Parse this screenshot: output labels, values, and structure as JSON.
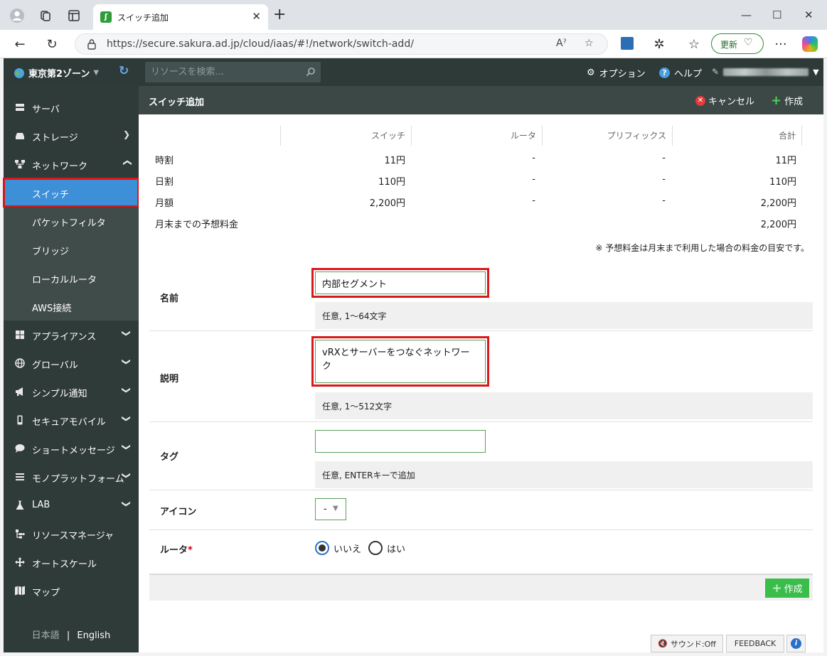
{
  "browser": {
    "tab_title": "スイッチ追加",
    "url": "https://secure.sakura.ad.jp/cloud/iaas/#!/network/switch-add/",
    "update_label": "更新"
  },
  "header": {
    "zone": "東京第2ゾーン",
    "search_placeholder": "リソースを検索...",
    "options_label": "オプション",
    "help_label": "ヘルプ"
  },
  "sidebar": {
    "items": [
      {
        "label": "サーバ",
        "icon": "server-icon"
      },
      {
        "label": "ストレージ",
        "icon": "storage-icon"
      },
      {
        "label": "ネットワーク",
        "icon": "network-icon"
      },
      {
        "label": "スイッチ"
      },
      {
        "label": "パケットフィルタ"
      },
      {
        "label": "ブリッジ"
      },
      {
        "label": "ローカルルータ"
      },
      {
        "label": "AWS接続"
      },
      {
        "label": "アプライアンス",
        "icon": "appliance-icon"
      },
      {
        "label": "グローバル",
        "icon": "globe-icon"
      },
      {
        "label": "シンプル通知",
        "icon": "megaphone-icon"
      },
      {
        "label": "セキュアモバイル",
        "icon": "mobile-icon"
      },
      {
        "label": "ショートメッセージ",
        "icon": "chat-icon"
      },
      {
        "label": "モノプラットフォーム",
        "icon": "list-icon"
      },
      {
        "label": "LAB",
        "icon": "flask-icon"
      },
      {
        "label": "リソースマネージャ",
        "icon": "sitemap-icon"
      },
      {
        "label": "オートスケール",
        "icon": "move-icon"
      },
      {
        "label": "マップ",
        "icon": "map-icon"
      }
    ],
    "lang_ja": "日本語",
    "lang_sep": "|",
    "lang_en": "English"
  },
  "panel": {
    "title": "スイッチ追加",
    "cancel_label": "キャンセル",
    "create_label": "作成"
  },
  "pricing": {
    "headers": [
      "スイッチ",
      "ルータ",
      "プリフィックス",
      "合計"
    ],
    "rows": [
      {
        "label": "時割",
        "values": [
          "11円",
          "-",
          "-",
          "11円"
        ]
      },
      {
        "label": "日割",
        "values": [
          "110円",
          "-",
          "-",
          "110円"
        ]
      },
      {
        "label": "月額",
        "values": [
          "2,200円",
          "-",
          "-",
          "2,200円"
        ]
      },
      {
        "label": "月末までの予想料金",
        "values": [
          "",
          "",
          "",
          "2,200円"
        ]
      }
    ],
    "note": "※ 予想料金は月末まで利用した場合の料金の目安です。"
  },
  "form": {
    "name_label": "名前",
    "name_value": "内部セグメント",
    "name_hint": "任意, 1〜64文字",
    "desc_label": "説明",
    "desc_value": "vRXとサーバーをつなぐネットワーク",
    "desc_hint": "任意, 1〜512文字",
    "tag_label": "タグ",
    "tag_value": "",
    "tag_hint": "任意, ENTERキーで追加",
    "icon_label": "アイコン",
    "icon_value": "-",
    "router_label": "ルータ",
    "router_required": "*",
    "router_no": "いいえ",
    "router_yes": "はい",
    "router_selected": "いいえ",
    "submit_label": "作成"
  },
  "bottom": {
    "sound_label": "サウンド:Off",
    "feedback_label": "FEEDBACK"
  },
  "colors": {
    "header_bg": "#2d3a38",
    "sidebar_bg": "#2f3b39",
    "active_item": "#3d8fd8",
    "highlight_frame": "#d91919",
    "create_green": "#3bbd4b"
  }
}
